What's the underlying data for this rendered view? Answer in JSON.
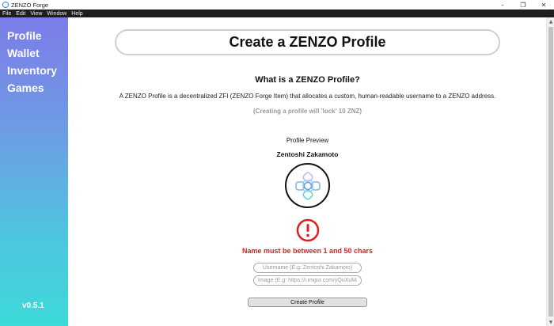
{
  "window": {
    "title": "ZENZO Forge",
    "icons": {
      "app": "zenzo-app-icon",
      "minimize": "minimize-icon",
      "maximize": "maximize-icon",
      "close": "close-icon"
    }
  },
  "menu": {
    "items": [
      "File",
      "Edit",
      "View",
      "Window",
      "Help"
    ]
  },
  "sidebar": {
    "items": [
      "Profile",
      "Wallet",
      "Inventory",
      "Games"
    ],
    "version": "v0.5.1"
  },
  "main": {
    "header": "Create a ZENZO Profile",
    "section_title": "What is a ZENZO Profile?",
    "description": "A ZENZO Profile is a decentralized ZFI (ZENZO Forge Item) that allocates a custom, human-readable username to a ZENZO address.",
    "lock_note": "(Creating a profile will 'lock' 10 ZNZ)",
    "preview_label": "Profile Preview",
    "preview_name": "Zentoshi Zakamoto",
    "avatar_icon": "zenzo-logo-icon",
    "error_icon": "exclamation-circle-icon",
    "error_message": "Name must be between 1 and 50 chars",
    "username_placeholder": "Username (E.g: Zentoshi Zakamoto)",
    "image_placeholder": "Image (E.g: https://i.imgur.com/yQuXuMa.png)",
    "create_button": "Create Profile"
  },
  "colors": {
    "sidebar_top": "#7c7ce8",
    "sidebar_bottom": "#3cdad8",
    "error": "#e02020",
    "menubar": "#1e1e1e"
  }
}
